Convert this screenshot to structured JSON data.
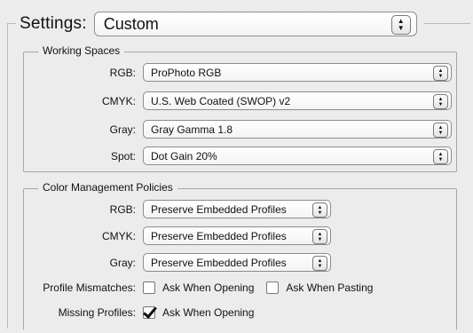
{
  "settings": {
    "label": "Settings:",
    "value": "Custom"
  },
  "working_spaces": {
    "title": "Working Spaces",
    "rows": [
      {
        "label": "RGB:",
        "value": "ProPhoto RGB"
      },
      {
        "label": "CMYK:",
        "value": "U.S. Web Coated (SWOP) v2"
      },
      {
        "label": "Gray:",
        "value": "Gray Gamma 1.8"
      },
      {
        "label": "Spot:",
        "value": "Dot Gain 20%"
      }
    ]
  },
  "color_management": {
    "title": "Color Management Policies",
    "rows": [
      {
        "label": "RGB:",
        "value": "Preserve Embedded Profiles"
      },
      {
        "label": "CMYK:",
        "value": "Preserve Embedded Profiles"
      },
      {
        "label": "Gray:",
        "value": "Preserve Embedded Profiles"
      }
    ],
    "profile_mismatches": {
      "label": "Profile Mismatches:",
      "ask_opening": {
        "label": "Ask When Opening",
        "checked": false
      },
      "ask_pasting": {
        "label": "Ask When Pasting",
        "checked": false
      }
    },
    "missing_profiles": {
      "label": "Missing Profiles:",
      "ask_opening": {
        "label": "Ask When Opening",
        "checked": true
      }
    }
  }
}
